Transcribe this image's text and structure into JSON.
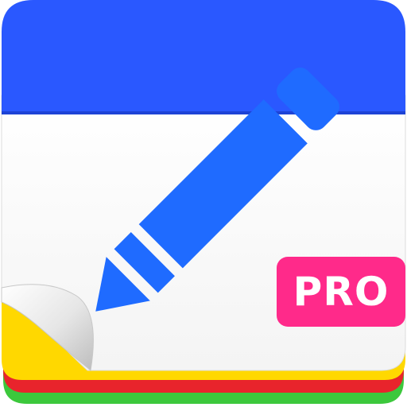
{
  "icon": {
    "badge_label": "PRO",
    "glyph": "pencil-icon",
    "colors": {
      "header_blue": "#2a58ff",
      "pencil_blue": "#1f6bff",
      "page_white": "#ffffff",
      "badge_pink": "#ff2a8a",
      "sheet_yellow": "#ffd800",
      "sheet_red": "#e8242c",
      "sheet_green": "#3cc83c"
    }
  }
}
